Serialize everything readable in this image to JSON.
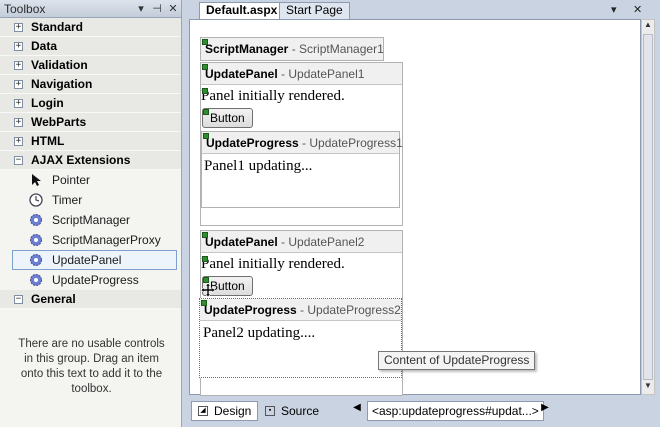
{
  "toolbox": {
    "title": "Toolbox",
    "controls": {
      "dropdown": "▾",
      "pin": "⊣",
      "close": "✕"
    },
    "categories": [
      {
        "label": "Standard",
        "expander": "+"
      },
      {
        "label": "Data",
        "expander": "+"
      },
      {
        "label": "Validation",
        "expander": "+"
      },
      {
        "label": "Navigation",
        "expander": "+"
      },
      {
        "label": "Login",
        "expander": "+"
      },
      {
        "label": "WebParts",
        "expander": "+"
      },
      {
        "label": "HTML",
        "expander": "+"
      },
      {
        "label": "AJAX Extensions",
        "expander": "−"
      }
    ],
    "ajax_items": [
      {
        "label": "Pointer",
        "icon": "pointer-icon"
      },
      {
        "label": "Timer",
        "icon": "clock-icon"
      },
      {
        "label": "ScriptManager",
        "icon": "gear-icon"
      },
      {
        "label": "ScriptManagerProxy",
        "icon": "gear-icon"
      },
      {
        "label": "UpdatePanel",
        "icon": "gear-icon",
        "selected": true
      },
      {
        "label": "UpdateProgress",
        "icon": "gear-icon"
      }
    ],
    "general": {
      "label": "General",
      "expander": "−"
    },
    "empty_note": "There are no usable controls in this group. Drag an item onto this text to add it to the toolbox."
  },
  "tabs": {
    "active": "Default.aspx",
    "inactive": "Start Page",
    "dropdown": "▾",
    "close": "✕"
  },
  "design_surface": {
    "script_manager": {
      "type": "ScriptManager",
      "id": "ScriptManager1"
    },
    "update_panel_1": {
      "type": "UpdatePanel",
      "id": "UpdatePanel1",
      "text": "Panel initially rendered.",
      "button": "Button",
      "progress": {
        "type": "UpdateProgress",
        "id": "UpdateProgress1",
        "text": "Panel1 updating..."
      }
    },
    "update_panel_2": {
      "type": "UpdatePanel",
      "id": "UpdatePanel2",
      "text": "Panel initially rendered.",
      "button": "Button",
      "progress": {
        "type": "UpdateProgress",
        "id": "UpdateProgress2",
        "text": "Panel2 updating...."
      }
    },
    "tooltip": "Content of UpdateProgress"
  },
  "bottom_bar": {
    "design": "Design",
    "source": "Source",
    "tag": "<asp:updateprogress#updat...>"
  }
}
